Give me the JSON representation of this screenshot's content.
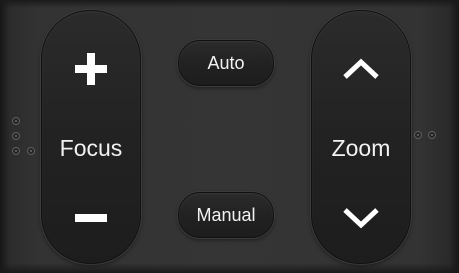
{
  "focus": {
    "label": "Focus",
    "increase_icon": "plus-icon",
    "decrease_icon": "minus-icon"
  },
  "zoom": {
    "label": "Zoom",
    "increase_icon": "chevron-up-icon",
    "decrease_icon": "chevron-down-icon"
  },
  "buttons": {
    "auto_label": "Auto",
    "manual_label": "Manual"
  },
  "colors": {
    "panel": "#333333",
    "button_face": "#222222",
    "text": "#f2f2f2"
  }
}
